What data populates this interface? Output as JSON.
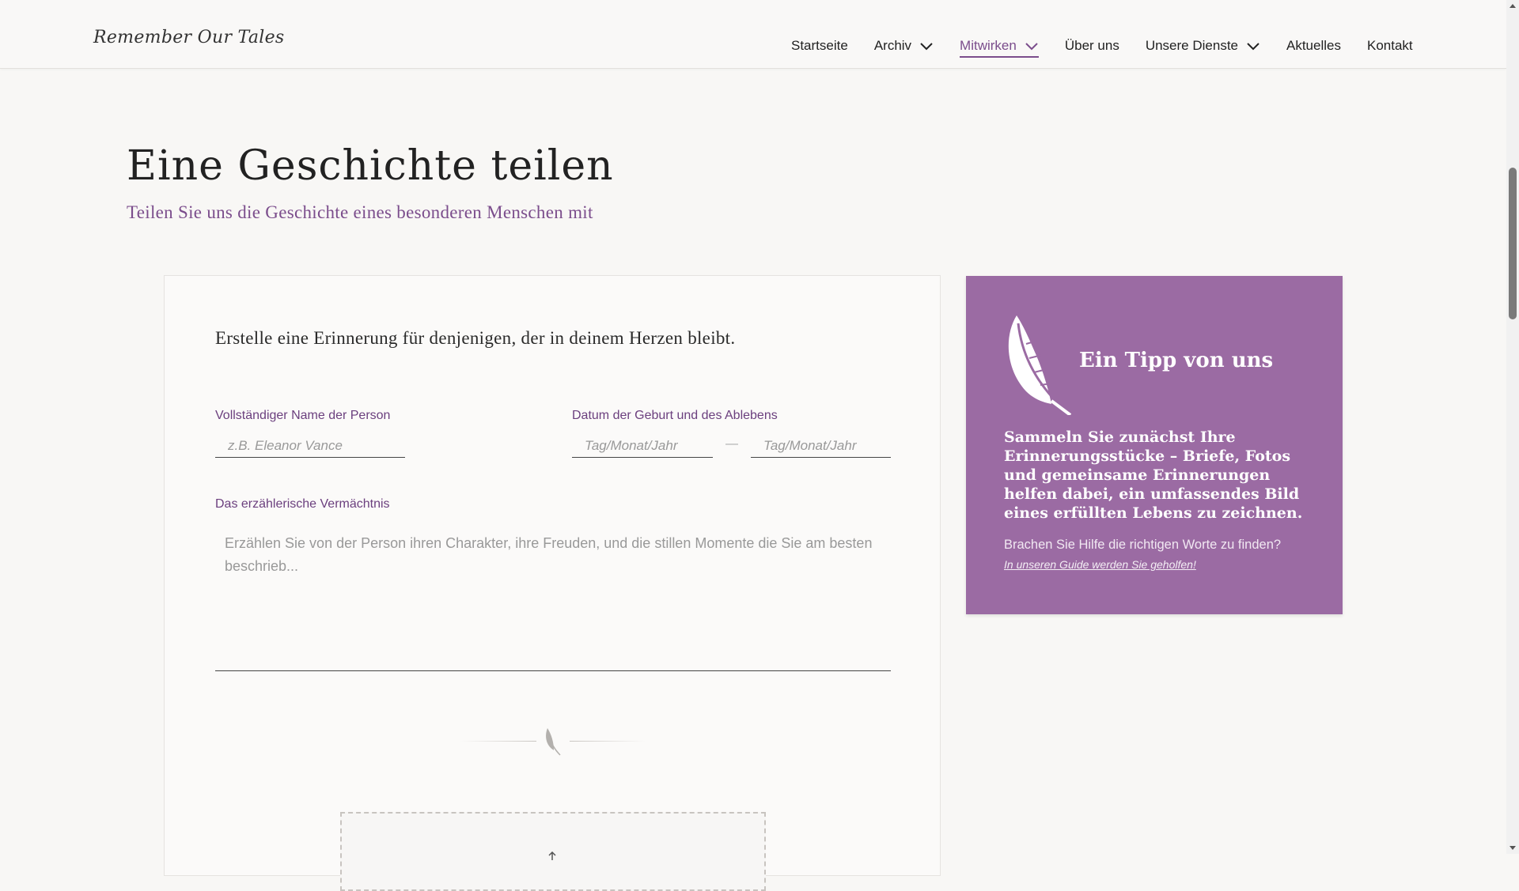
{
  "header": {
    "logo_text": "Remember Our Tales",
    "nav": [
      {
        "label": "Startseite",
        "dropdown": false,
        "active": false
      },
      {
        "label": "Archiv",
        "dropdown": true,
        "active": false
      },
      {
        "label": "Mitwirken",
        "dropdown": true,
        "active": true
      },
      {
        "label": "Über uns",
        "dropdown": false,
        "active": false
      },
      {
        "label": "Unsere Dienste",
        "dropdown": true,
        "active": false
      },
      {
        "label": "Aktuelles",
        "dropdown": false,
        "active": false
      },
      {
        "label": "Kontakt",
        "dropdown": false,
        "active": false
      }
    ]
  },
  "page": {
    "title": "Eine Geschichte teilen",
    "subtitle": "Teilen Sie uns die Geschichte eines besonderen Menschen mit"
  },
  "form": {
    "intro": "Erstelle eine Erinnerung für denjenigen, der in deinem Herzen bleibt.",
    "name_label": "Vollständiger Name der Person",
    "name_placeholder": "z.B. Eleanor Vance",
    "dates_label": "Datum der Geburt und des Ablebens",
    "birth_placeholder": "Tag/Monat/Jahr",
    "date_separator": "—",
    "death_placeholder": "Tag/Monat/Jahr",
    "legacy_label": "Das erzählerische Vermächtnis",
    "legacy_placeholder": "Erzählen Sie von der Person ihren Charakter, ihre Freuden, und die stillen Momente die Sie am besten beschrieb..."
  },
  "tip": {
    "title": "Ein Tipp von uns",
    "body": "Sammeln Sie zunächst Ihre Erinnerungsstücke – Briefe, Fotos und gemeinsame Erinnerungen helfen dabei, ein umfassendes Bild eines erfüllten Lebens zu zeichnen.",
    "help_text": "Brachen Sie Hilfe die richtigen Worte zu finden?",
    "link_text": "In unseren Guide werden Sie geholfen!"
  },
  "colors": {
    "accent": "#7b4d8c",
    "tip_background": "#9b6ba3",
    "page_background": "#f8f7f5"
  },
  "icons": [
    "book-quill-logo-icon",
    "chevron-down-icon",
    "feather-icon",
    "upload-icon"
  ]
}
